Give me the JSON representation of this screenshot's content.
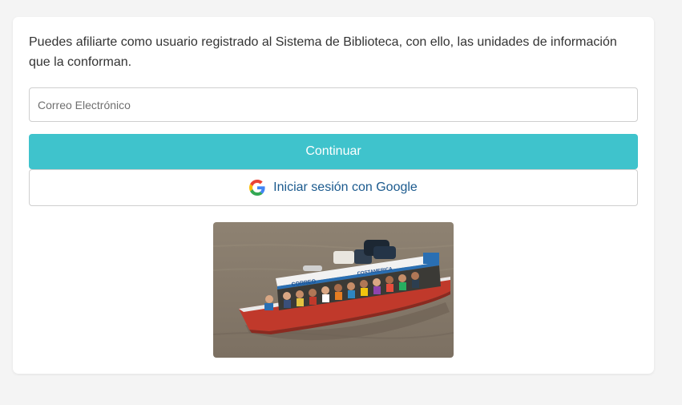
{
  "intro": {
    "text": "Puedes afiliarte como usuario registrado al Sistema de Biblioteca, con ello, las unidades de información que la conforman."
  },
  "email": {
    "placeholder": "Correo Electrónico",
    "value": ""
  },
  "buttons": {
    "continue_label": "Continuar",
    "google_label": "Iniciar sesión con Google",
    "google_icon": "google-g-icon"
  },
  "photo": {
    "subject": "river-boat-photo",
    "boat_name": "CORREO",
    "boat_side_text": "COSTAMERICA"
  },
  "colors": {
    "page_bg": "#f4f4f4",
    "card_bg": "#ffffff",
    "continue_bg": "#3fc3cc",
    "google_text": "#1b5a8e",
    "intro_text": "#333333"
  }
}
